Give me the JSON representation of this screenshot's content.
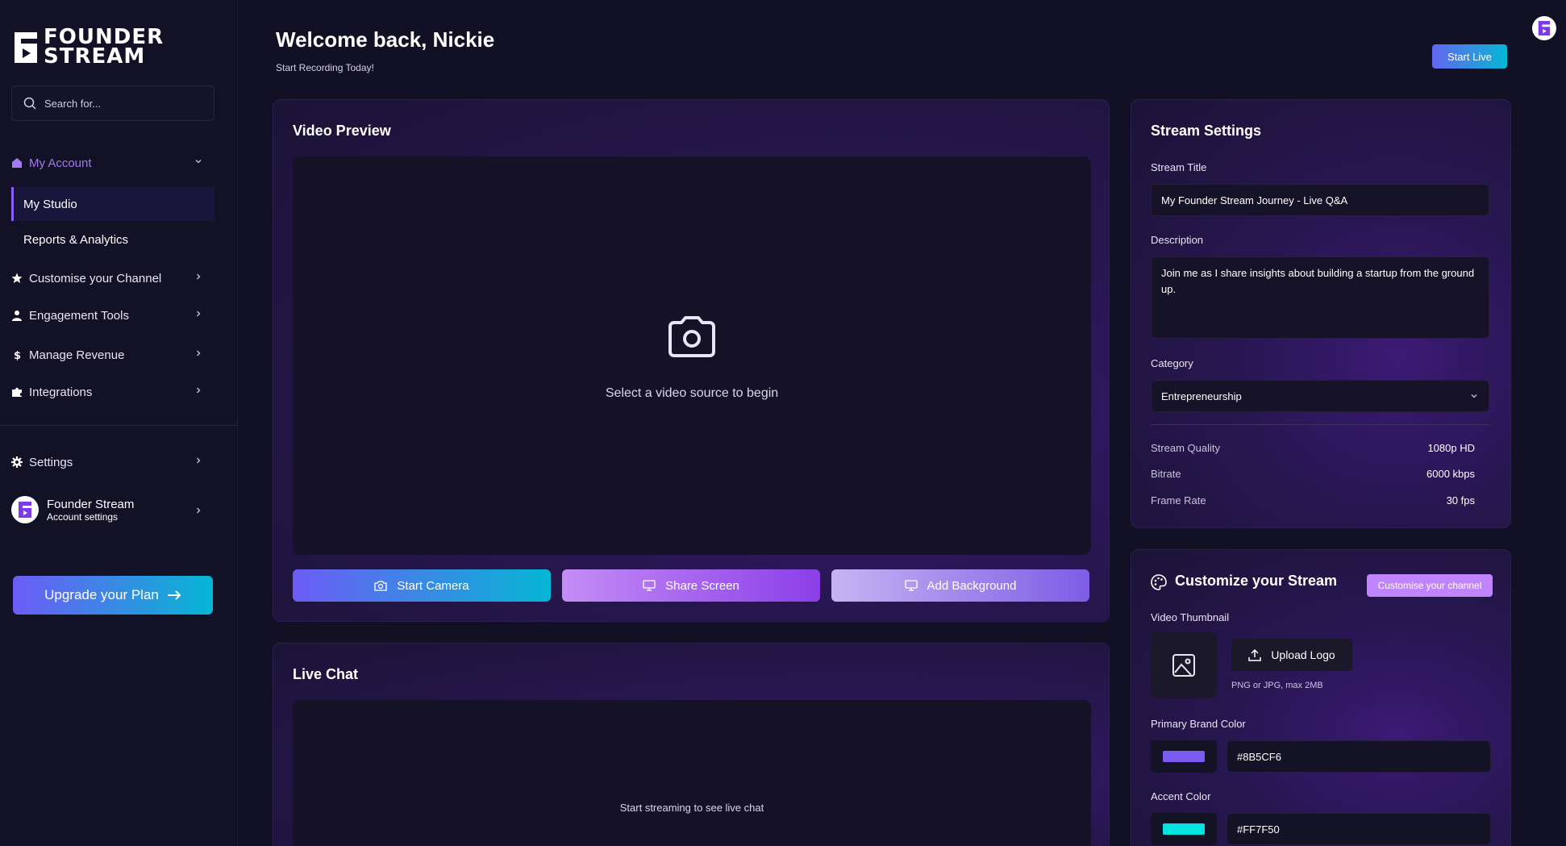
{
  "sidebar": {
    "logo": {
      "line1": "FOUNDER",
      "line2": "STREAM"
    },
    "search": {
      "placeholder": "Search for..."
    },
    "my_account": "My Account",
    "my_studio": "My Studio",
    "reports": "Reports & Analytics",
    "customise": "Customise your Channel",
    "engagement": "Engagement Tools",
    "revenue": "Manage Revenue",
    "integrations": "Integrations",
    "settings": "Settings",
    "account": {
      "name": "Founder Stream",
      "sub": "Account settings"
    },
    "upgrade_label": "Upgrade your Plan"
  },
  "header": {
    "title": "Welcome back, Nickie",
    "subtitle": "Start Recording Today!",
    "start_live": "Start Live"
  },
  "video_preview": {
    "title": "Video Preview",
    "message": "Select a video source to begin",
    "start_camera": "Start Camera",
    "share_screen": "Share Screen",
    "add_background": "Add Background"
  },
  "live_chat": {
    "title": "Live Chat",
    "message": "Start streaming to see live chat"
  },
  "stream_settings": {
    "title": "Stream Settings",
    "stream_title_label": "Stream Title",
    "stream_title_value": "My Founder Stream Journey - Live Q&A",
    "description_label": "Description",
    "description_value": "Join me as I share insights about building a startup from the ground up.",
    "category_label": "Category",
    "category_value": "Entrepreneurship",
    "stats": [
      {
        "label": "Stream Quality",
        "value": "1080p HD"
      },
      {
        "label": "Bitrate",
        "value": "6000 kbps"
      },
      {
        "label": "Frame Rate",
        "value": "30 fps"
      }
    ]
  },
  "customize": {
    "title": "Customize your Stream",
    "button": "Customise your channel",
    "thumbnail_label": "Video Thumbnail",
    "upload_label": "Upload Logo",
    "upload_note": "PNG or JPG, max 2MB",
    "primary_label": "Primary Brand Color",
    "primary_value": "#8B5CF6",
    "accent_label": "Accent Color",
    "accent_value": "#FF7F50"
  },
  "colors": {
    "accent_purple": "#8b5cf6",
    "primary_swatch": "#7c5cf0",
    "accent_swatch": "#00e5e0",
    "gradient_cyan": "#06b6d4"
  }
}
